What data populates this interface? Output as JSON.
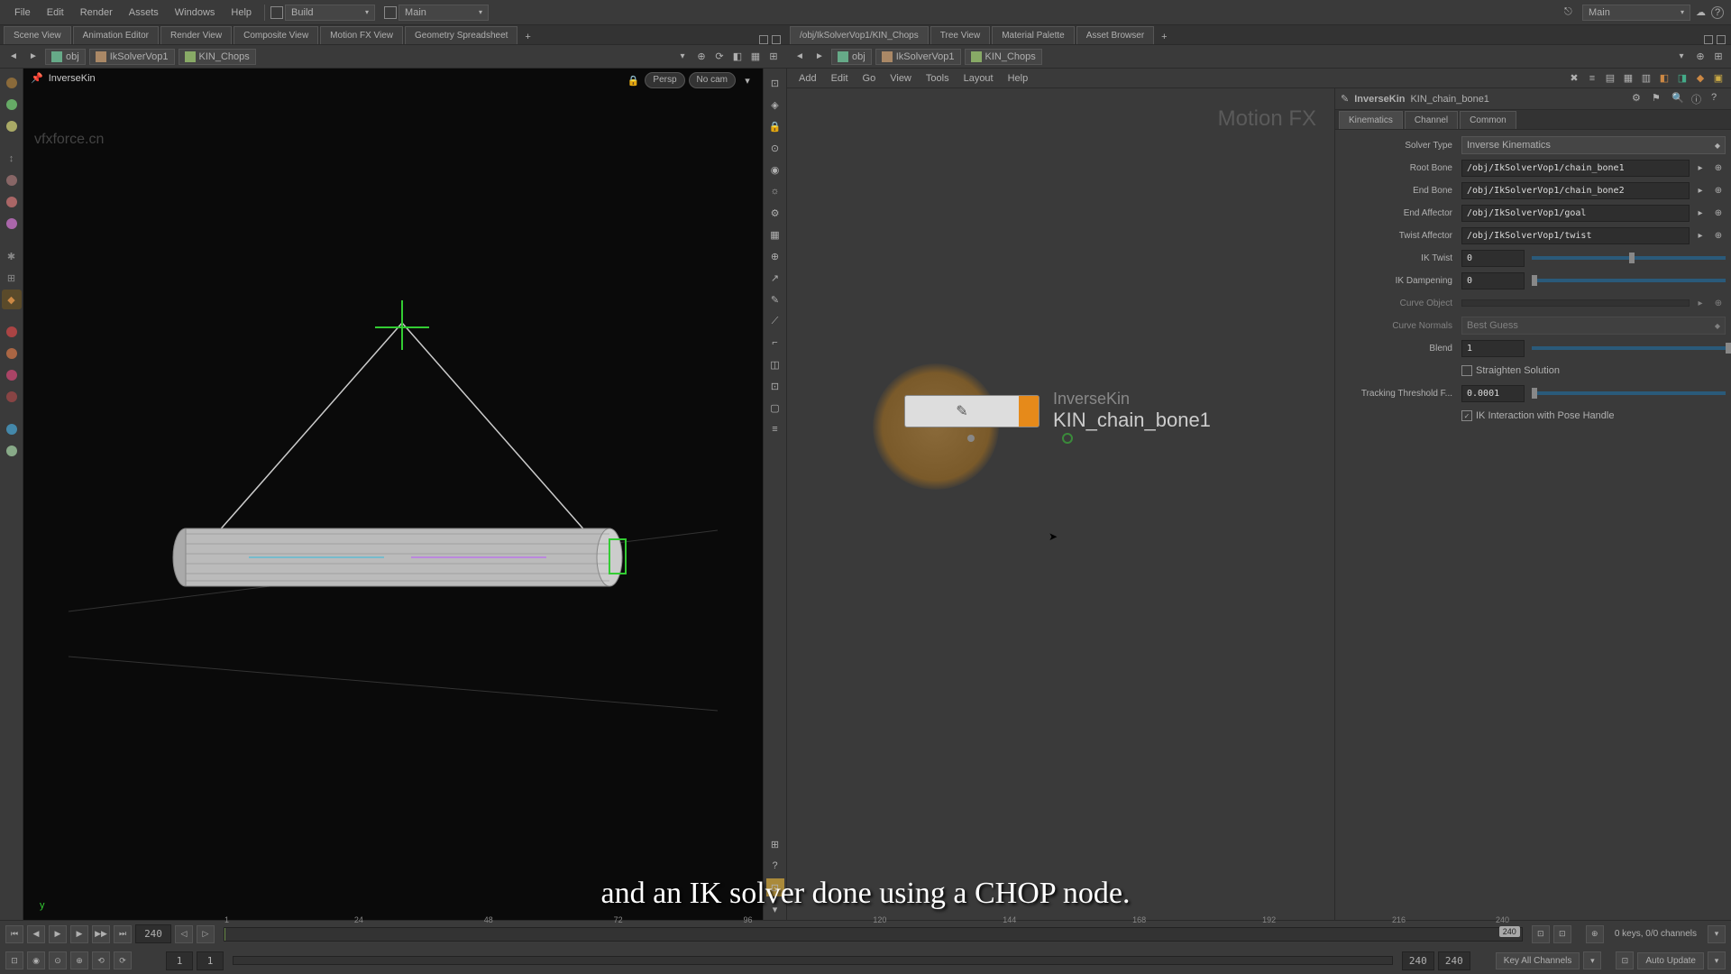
{
  "menu": {
    "file": "File",
    "edit": "Edit",
    "render": "Render",
    "assets": "Assets",
    "windows": "Windows",
    "help": "Help"
  },
  "desktop_dd": "Build",
  "main_dd": "Main",
  "right_main": "Main",
  "left_tabs": [
    "Scene View",
    "Animation Editor",
    "Render View",
    "Composite View",
    "Motion FX View",
    "Geometry Spreadsheet"
  ],
  "right_tabs": [
    "/obj/IkSolverVop1/KIN_Chops",
    "Tree View",
    "Material Palette",
    "Asset Browser"
  ],
  "path_left": {
    "obj": "obj",
    "n1": "IkSolverVop1",
    "n2": "KIN_Chops"
  },
  "path_right": {
    "obj": "obj",
    "n1": "IkSolverVop1",
    "n2": "KIN_Chops"
  },
  "vp": {
    "tool": "InverseKin",
    "persp": "Persp",
    "nocam": "No cam",
    "watermark": "vfxforce.cn",
    "axis": "y"
  },
  "net_menu": {
    "add": "Add",
    "edit": "Edit",
    "go": "Go",
    "view": "View",
    "tools": "Tools",
    "layout": "Layout",
    "help": "Help"
  },
  "net": {
    "title": "Motion FX",
    "node_type": "InverseKin",
    "node_name": "KIN_chain_bone1"
  },
  "params": {
    "head_type": "InverseKin",
    "head_name": "KIN_chain_bone1",
    "tabs": [
      "Kinematics",
      "Channel",
      "Common"
    ],
    "solver_label": "Solver Type",
    "solver_val": "Inverse Kinematics",
    "root_label": "Root Bone",
    "root_val": "/obj/IkSolverVop1/chain_bone1",
    "end_label": "End Bone",
    "end_val": "/obj/IkSolverVop1/chain_bone2",
    "aff_label": "End Affector",
    "aff_val": "/obj/IkSolverVop1/goal",
    "twist_label": "Twist Affector",
    "twist_val": "/obj/IkSolverVop1/twist",
    "iktwist_label": "IK Twist",
    "iktwist_val": "0",
    "damp_label": "IK Dampening",
    "damp_val": "0",
    "curve_label": "Curve Object",
    "norm_label": "Curve Normals",
    "norm_val": "Best Guess",
    "blend_label": "Blend",
    "blend_val": "1",
    "straight_label": "Straighten Solution",
    "thresh_label": "Tracking Threshold F...",
    "thresh_val": "0.0001",
    "ikint_label": "IK Interaction with Pose Handle"
  },
  "timeline": {
    "frame": "240",
    "start1": "1",
    "start2": "1",
    "end1": "240",
    "end2": "240",
    "ticks": [
      "1",
      "24",
      "48",
      "72",
      "96",
      "120",
      "144",
      "168",
      "192",
      "216",
      "240"
    ],
    "badge": "240",
    "info": "0 keys, 0/0 channels",
    "keyall": "Key All Channels",
    "auto": "Auto Update"
  },
  "caption": "and an IK solver done using a CHOP node."
}
